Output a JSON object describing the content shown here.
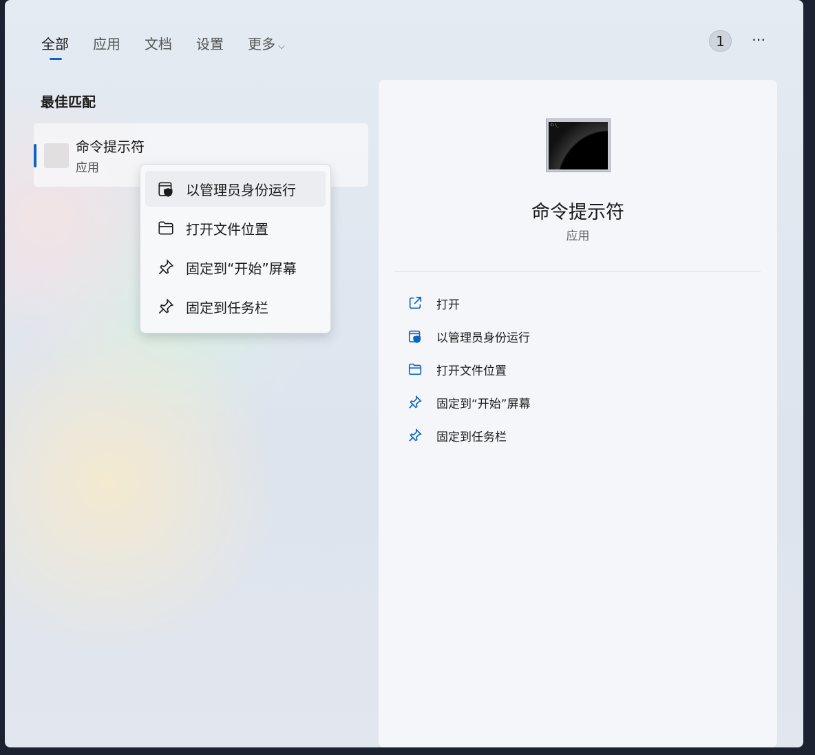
{
  "tabs": [
    {
      "label": "全部",
      "active": true
    },
    {
      "label": "应用"
    },
    {
      "label": "文档"
    },
    {
      "label": "设置"
    },
    {
      "label": "更多"
    }
  ],
  "badge_count": "1",
  "more_icon": "⋯",
  "best_match": {
    "heading": "最佳匹配",
    "title": "命令提示符",
    "subtitle": "应用"
  },
  "context_menu": [
    {
      "label": "以管理员身份运行",
      "icon": "shield-window-icon"
    },
    {
      "label": "打开文件位置",
      "icon": "folder-icon"
    },
    {
      "label": "固定到“开始”屏幕",
      "icon": "pin-icon"
    },
    {
      "label": "固定到任务栏",
      "icon": "pin-icon"
    }
  ],
  "detail": {
    "title": "命令提示符",
    "subtitle": "应用",
    "prompt": "C:\\_",
    "actions": [
      {
        "label": "打开",
        "icon": "open-external-icon"
      },
      {
        "label": "以管理员身份运行",
        "icon": "shield-window-icon"
      },
      {
        "label": "打开文件位置",
        "icon": "folder-icon"
      },
      {
        "label": "固定到“开始”屏幕",
        "icon": "pin-icon"
      },
      {
        "label": "固定到任务栏",
        "icon": "pin-icon"
      }
    ]
  },
  "colors": {
    "accent": "#0a64c4"
  }
}
